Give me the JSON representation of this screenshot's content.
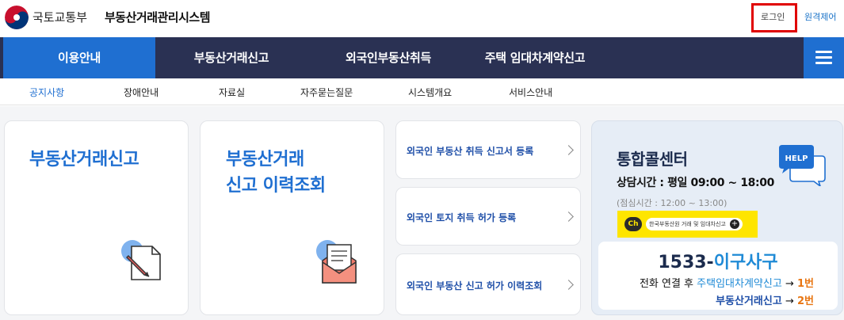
{
  "header": {
    "ministry": "국토교통부",
    "system_title": "부동산거래관리시스템",
    "login_label": "로그인",
    "remote_label": "원격제어"
  },
  "main_nav": {
    "items": [
      {
        "label": "이용안내",
        "active": true
      },
      {
        "label": "부동산거래신고",
        "active": false
      },
      {
        "label": "외국인부동산취득",
        "active": false
      },
      {
        "label": "주택 임대차계약신고",
        "active": false
      }
    ],
    "menu_icon": "hamburger-icon"
  },
  "sub_nav": {
    "items": [
      {
        "label": "공지사항",
        "active": true
      },
      {
        "label": "장애안내",
        "active": false
      },
      {
        "label": "자료실",
        "active": false
      },
      {
        "label": "자주묻는질문",
        "active": false
      },
      {
        "label": "시스템개요",
        "active": false
      },
      {
        "label": "서비스안내",
        "active": false
      }
    ]
  },
  "cards": {
    "report": {
      "title": "부동산거래신고",
      "icon": "document-pen-icon"
    },
    "history": {
      "title_line1": "부동산거래",
      "title_line2": "신고 이력조회",
      "icon": "envelope-icon"
    }
  },
  "links": [
    {
      "label": "외국인 부동산 취득 신고서 등록"
    },
    {
      "label": "외국인 토지 취득 허가 등록"
    },
    {
      "label": "외국인 부동산 신고 허가 이력조회"
    }
  ],
  "call_center": {
    "title": "통합콜센터",
    "hours": "상담시간 : 평일 09:00 ~ 18:00",
    "break": "(점심시간 : 12:00 ~ 13:00)",
    "kakao_ch": "Ch",
    "kakao_text": "한국부동산원 거래 및 임대차신고",
    "help_icon_text": "HELP",
    "phone_number": "1533-",
    "phone_word": "이구사구",
    "row1_prefix": "전화 연결 후",
    "row1_menu": "주택임대차계약신고",
    "row1_arrow": "→",
    "row1_num": "1번",
    "row2_menu": "부동산거래신고",
    "row2_arrow": "→",
    "row2_num": "2번"
  },
  "colors": {
    "nav_bg": "#2a3153",
    "accent": "#1f6fd1",
    "highlight_box": "#e00000",
    "kakao_yellow": "#fee500",
    "orange": "#e87511"
  }
}
